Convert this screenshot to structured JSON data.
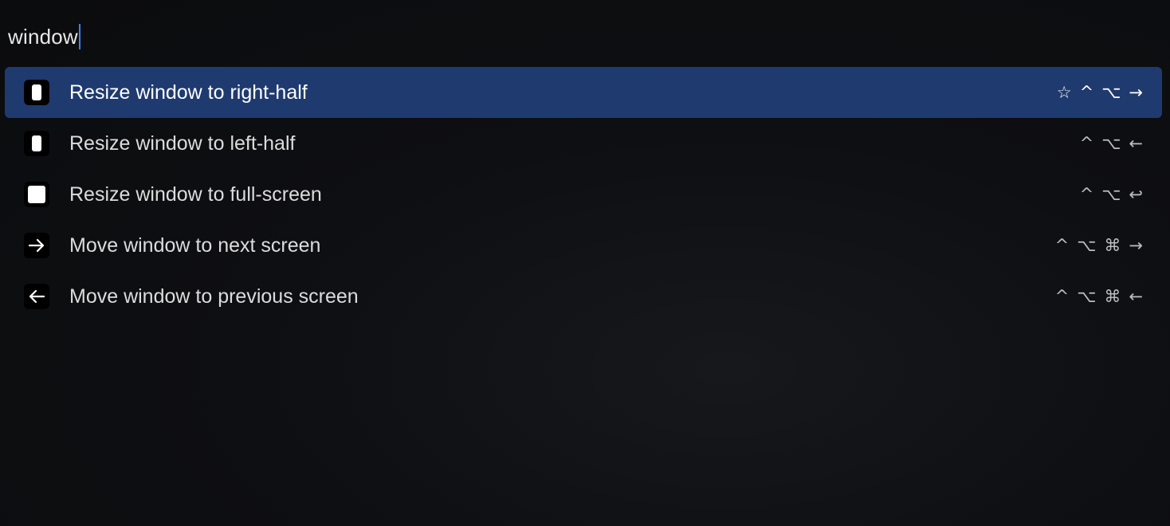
{
  "search": {
    "query": "window"
  },
  "results": [
    {
      "label": "Resize window to right-half",
      "icon": "half-window-icon",
      "selected": true,
      "shortcut": [
        "☆",
        "^",
        "⌥",
        "→"
      ]
    },
    {
      "label": "Resize window to left-half",
      "icon": "half-window-icon",
      "selected": false,
      "shortcut": [
        "^",
        "⌥",
        "←"
      ]
    },
    {
      "label": "Resize window to full-screen",
      "icon": "full-window-icon",
      "selected": false,
      "shortcut": [
        "^",
        "⌥",
        "↩"
      ]
    },
    {
      "label": "Move window to next screen",
      "icon": "arrow-right-icon",
      "selected": false,
      "shortcut": [
        "^",
        "⌥",
        "⌘",
        "→"
      ]
    },
    {
      "label": "Move window to previous screen",
      "icon": "arrow-left-icon",
      "selected": false,
      "shortcut": [
        "^",
        "⌥",
        "⌘",
        "←"
      ]
    }
  ],
  "colors": {
    "selection": "#1f3a6e",
    "caret": "#3b82f6",
    "background": "#0d0e10"
  }
}
